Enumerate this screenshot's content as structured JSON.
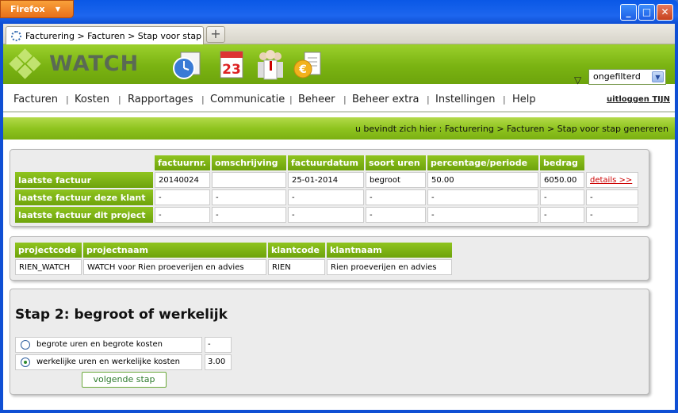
{
  "browser": {
    "app_button": "Firefox",
    "tab_title": "Facturering > Facturen > Stap voor stap ge...",
    "new_tab": "+"
  },
  "header": {
    "logo": "WATCH",
    "filter_value": "ongefilterd"
  },
  "nav": {
    "items": [
      "Facturen",
      "Kosten",
      "Rapportages",
      "Communicatie",
      "Beheer",
      "Beheer extra",
      "Instellingen",
      "Help"
    ],
    "logout": "uitloggen TIJN"
  },
  "breadcrumb": "u bevindt zich hier : Facturering > Facturen > Stap voor stap genereren",
  "invoice_table": {
    "headers": [
      "factuurnr.",
      "omschrijving",
      "factuurdatum",
      "soort uren",
      "percentage/periode",
      "bedrag"
    ],
    "rows": [
      {
        "label": "laatste factuur",
        "cells": [
          "20140024",
          "",
          "25-01-2014",
          "begroot",
          "50.00",
          "6050.00"
        ],
        "link": "details >>"
      },
      {
        "label": "laatste factuur deze klant",
        "cells": [
          "-",
          "-",
          "-",
          "-",
          "-",
          "-"
        ],
        "link": "-"
      },
      {
        "label": "laatste factuur dit project",
        "cells": [
          "-",
          "-",
          "-",
          "-",
          "-",
          "-"
        ],
        "link": "-"
      }
    ]
  },
  "project_table": {
    "headers": [
      "projectcode",
      "projectnaam",
      "klantcode",
      "klantnaam"
    ],
    "row": [
      "RIEN_WATCH",
      "WATCH voor Rien proeverijen en advies",
      "RIEN",
      "Rien proeverijen en advies"
    ]
  },
  "step": {
    "title": "Stap 2: begroot of werkelijk",
    "options": [
      {
        "label": "begrote uren en begrote kosten",
        "value": "-",
        "selected": false
      },
      {
        "label": "werkelijke uren en werkelijke kosten",
        "value": "3.00",
        "selected": true
      }
    ],
    "next_button": "volgende stap"
  },
  "colors": {
    "accent_green": "#7ab312",
    "link_red": "#cc0000"
  }
}
